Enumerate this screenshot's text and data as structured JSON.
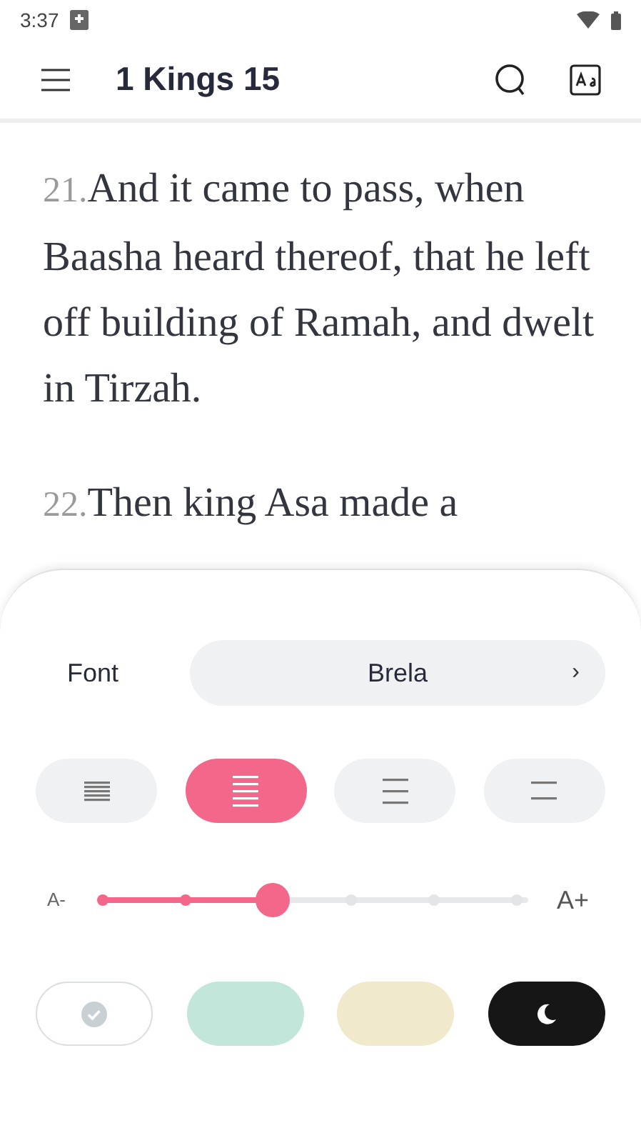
{
  "status_bar": {
    "time": "3:37"
  },
  "header": {
    "title": "1 Kings 15"
  },
  "verses": [
    {
      "number": "21.",
      "text": "And it came to pass, when Baasha heard thereof, that he left off building of Ramah, and dwelt in Tirzah."
    },
    {
      "number": "22.",
      "text": "Then king Asa made a"
    }
  ],
  "settings": {
    "font": {
      "label": "Font",
      "value": "Brela",
      "arrow": "›"
    },
    "spacing": [
      {
        "kind": "compact",
        "selected": false
      },
      {
        "kind": "normal",
        "selected": true
      },
      {
        "kind": "wide",
        "selected": false
      },
      {
        "kind": "wider",
        "selected": false
      }
    ],
    "size": {
      "min_label": "A-",
      "max_label": "A+",
      "level": 0.4
    },
    "themes": [
      {
        "kind": "plain",
        "color": "#ffffff",
        "selected": true
      },
      {
        "kind": "plain",
        "color": "#c2e6d9",
        "selected": false
      },
      {
        "kind": "plain",
        "color": "#f0e9cc",
        "selected": false
      },
      {
        "kind": "night",
        "color": "#161616",
        "selected": false
      }
    ]
  }
}
